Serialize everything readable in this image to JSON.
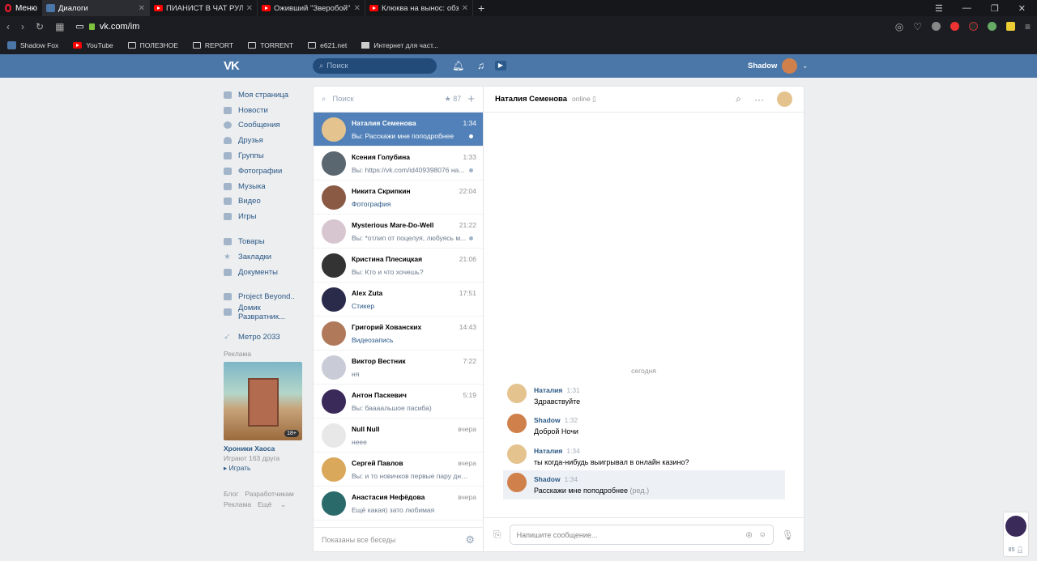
{
  "browser": {
    "menu": "Меню",
    "tabs": [
      {
        "title": "Диалоги",
        "active": true,
        "icon": "vk-icon"
      },
      {
        "title": "ПИАНИСТ В ЧАТ РУЛЕТКЕ",
        "active": false,
        "icon": "youtube-icon"
      },
      {
        "title": "Оживший \"Зверобой\" ИС",
        "active": false,
        "icon": "youtube-icon"
      },
      {
        "title": "Клюква на вынос: обзор",
        "active": false,
        "icon": "youtube-icon"
      }
    ],
    "url": "vk.com/im",
    "bookmarks": [
      "Shadow Fox",
      "YouTube",
      "ПОЛЕЗНОЕ",
      "REPORT",
      "TORRENT",
      "e621.net",
      "Интернет для част..."
    ]
  },
  "header": {
    "search_placeholder": "Поиск",
    "user": "Shadow"
  },
  "leftnav": {
    "main": [
      "Моя страница",
      "Новости",
      "Сообщения",
      "Друзья",
      "Группы",
      "Фотографии",
      "Музыка",
      "Видео",
      "Игры"
    ],
    "second": [
      "Товары",
      "Закладки",
      "Документы"
    ],
    "groups": [
      "Project Beyond..",
      "Домик Развратник..."
    ],
    "apps": [
      "Метро 2033"
    ],
    "ad_label": "Реклама",
    "ad_title": "Хроники Хаоса",
    "ad_sub": "Играют 163 друга",
    "ad_play": "Играть",
    "ad_age": "18+",
    "footer": [
      "Блог",
      "Разработчикам",
      "Реклама",
      "Ещё"
    ]
  },
  "dialogs": {
    "search_placeholder": "Поиск",
    "star_count": "87",
    "items": [
      {
        "name": "Наталия Семенова",
        "time": "1:34",
        "msg": "Вы: Расскажи мне поподробнее",
        "selected": true,
        "unread": true,
        "color": "#e5c38f",
        "link": false
      },
      {
        "name": "Ксения Голубина",
        "time": "1:33",
        "msg": "Вы: https://vk.com/id409398076 на...",
        "selected": false,
        "unread": true,
        "color": "#5a6670",
        "link": false
      },
      {
        "name": "Никита Скрипкин",
        "time": "22:04",
        "msg": "Фотография",
        "selected": false,
        "unread": false,
        "color": "#8a5a45",
        "link": true
      },
      {
        "name": "Mysterious Mare-Do-Well",
        "time": "21:22",
        "msg": "Вы: *отлип от поцелуя, любуясь м...",
        "selected": false,
        "unread": true,
        "color": "#d7c6cf",
        "link": false
      },
      {
        "name": "Кристина Плесицкая",
        "time": "21:06",
        "msg": "Вы: Кто и что хочешь?",
        "selected": false,
        "unread": false,
        "color": "#333333",
        "link": false
      },
      {
        "name": "Alex Zuta",
        "time": "17:51",
        "msg": "Стикер",
        "selected": false,
        "unread": false,
        "color": "#2a2a4a",
        "link": true
      },
      {
        "name": "Григорий Хованских",
        "time": "14:43",
        "msg": "Видеозапись",
        "selected": false,
        "unread": false,
        "color": "#b07a5a",
        "link": true
      },
      {
        "name": "Виктор Вестник",
        "time": "7:22",
        "msg": "ня",
        "selected": false,
        "unread": false,
        "color": "#c9cbd6",
        "link": false
      },
      {
        "name": "Антон Паскевич",
        "time": "5:19",
        "msg": "Вы: баааальшое пасиба)",
        "selected": false,
        "unread": false,
        "color": "#3a2a5a",
        "link": false
      },
      {
        "name": "Null Null",
        "time": "вчера",
        "msg": "неее",
        "selected": false,
        "unread": false,
        "color": "#e8e8e8",
        "link": false
      },
      {
        "name": "Сергей Павлов",
        "time": "вчера",
        "msg": "Вы: и то новичков первые пару дней",
        "selected": false,
        "unread": false,
        "color": "#d9a85a",
        "link": false
      },
      {
        "name": "Анастасия Нефёдова",
        "time": "вчера",
        "msg": "Ещё какая) зато любимая",
        "selected": false,
        "unread": false,
        "color": "#2a6a6a",
        "link": false
      }
    ],
    "footer": "Показаны все беседы"
  },
  "chat": {
    "name": "Наталия Семенова",
    "status": "online",
    "day": "сегодня",
    "messages": [
      {
        "from": "Наталия",
        "time": "1:31",
        "text": "Здравствуйте",
        "edited": "",
        "color": "#e5c38f",
        "hl": false
      },
      {
        "from": "Shadow",
        "time": "1:32",
        "text": "Доброй Ночи",
        "edited": "",
        "color": "#d0804a",
        "hl": false
      },
      {
        "from": "Наталия",
        "time": "1:34",
        "text": "ты когда-нибудь выигрывал в онлайн казино?",
        "edited": "",
        "color": "#e5c38f",
        "hl": false
      },
      {
        "from": "Shadow",
        "time": "1:34",
        "text": "Расскажи мне поподробнее",
        "edited": "(ред.)",
        "color": "#d0804a",
        "hl": true
      }
    ],
    "compose_placeholder": "Напишите сообщение..."
  },
  "mini": {
    "count": "85"
  }
}
